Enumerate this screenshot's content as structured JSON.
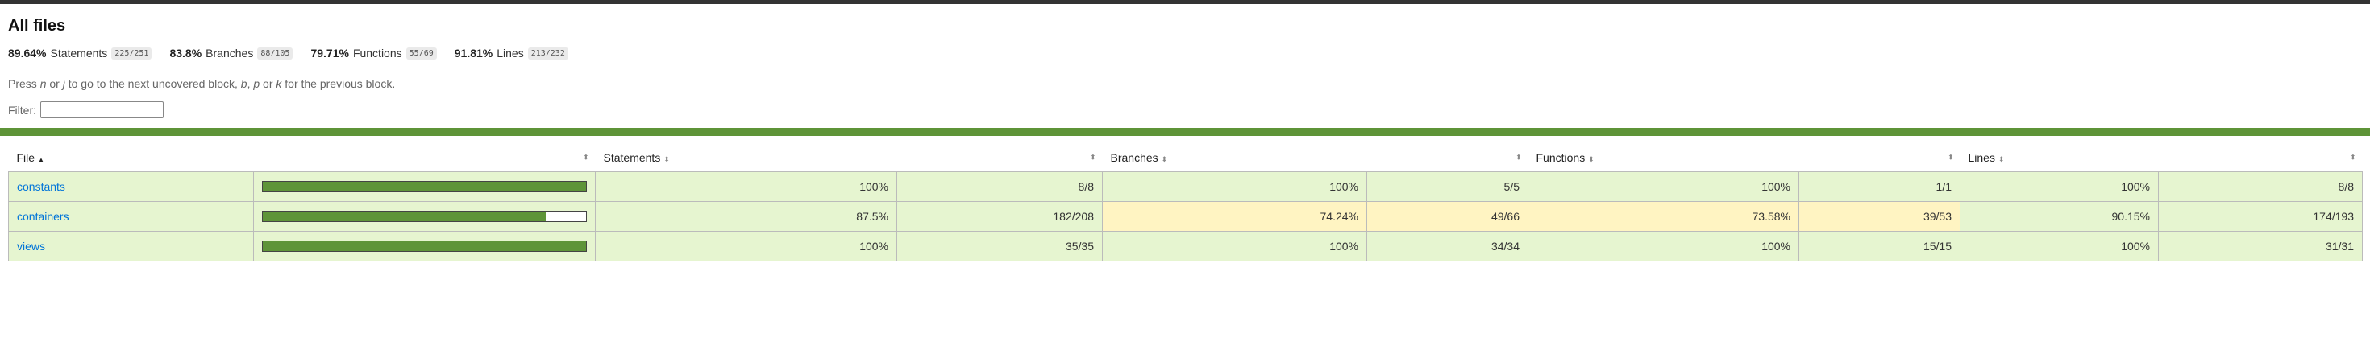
{
  "title": "All files",
  "summary": {
    "statements": {
      "pct": "89.64%",
      "label": "Statements",
      "fraction": "225/251"
    },
    "branches": {
      "pct": "83.8%",
      "label": "Branches",
      "fraction": "88/105"
    },
    "functions": {
      "pct": "79.71%",
      "label": "Functions",
      "fraction": "55/69"
    },
    "lines": {
      "pct": "91.81%",
      "label": "Lines",
      "fraction": "213/232"
    }
  },
  "hint": {
    "p1": "Press ",
    "k1": "n",
    "p2": " or ",
    "k2": "j",
    "p3": " to go to the next uncovered block, ",
    "k3": "b",
    "p4": ", ",
    "k4": "p",
    "p5": " or ",
    "k5": "k",
    "p6": " for the previous block."
  },
  "filter": {
    "label": "Filter:",
    "value": ""
  },
  "columns": {
    "file": "File",
    "file_sort_icon": "▲",
    "sort_icon": "⬍",
    "statements": "Statements",
    "branches": "Branches",
    "functions": "Functions",
    "lines": "Lines"
  },
  "rows": [
    {
      "file": "constants",
      "coverage": 1.0,
      "stmt_pct": "100%",
      "stmt_frac": "8/8",
      "br_pct": "100%",
      "br_frac": "5/5",
      "fn_pct": "100%",
      "fn_frac": "1/1",
      "ln_pct": "100%",
      "ln_frac": "8/8"
    },
    {
      "file": "containers",
      "coverage": 0.875,
      "stmt_pct": "87.5%",
      "stmt_frac": "182/208",
      "br_pct": "74.24%",
      "br_frac": "49/66",
      "fn_pct": "73.58%",
      "fn_frac": "39/53",
      "ln_pct": "90.15%",
      "ln_frac": "174/193"
    },
    {
      "file": "views",
      "coverage": 1.0,
      "stmt_pct": "100%",
      "stmt_frac": "35/35",
      "br_pct": "100%",
      "br_frac": "34/34",
      "fn_pct": "100%",
      "fn_frac": "15/15",
      "ln_pct": "100%",
      "ln_frac": "31/31"
    }
  ]
}
